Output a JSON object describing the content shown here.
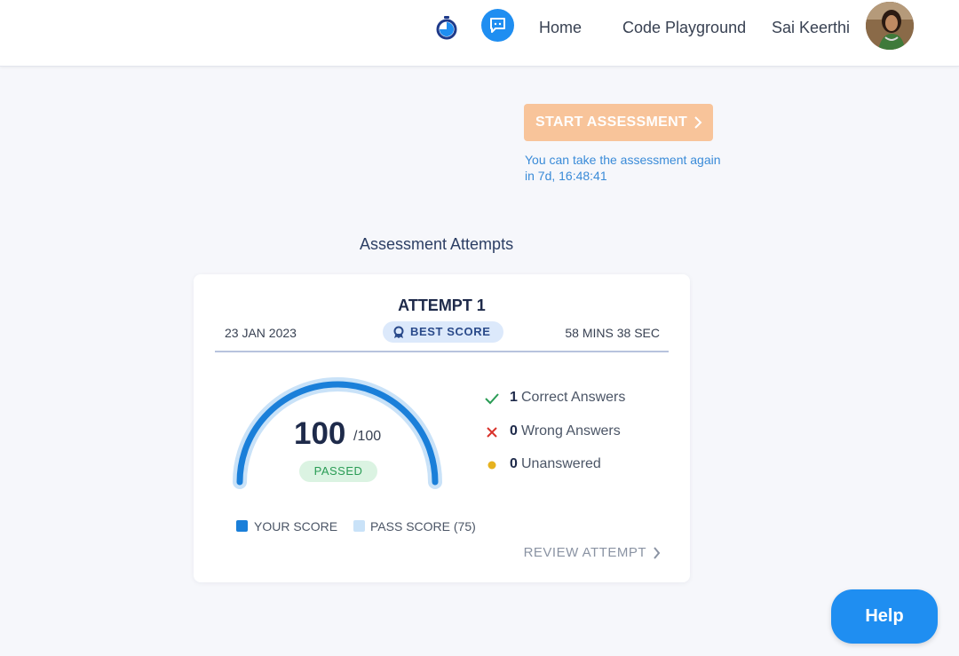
{
  "header": {
    "icons": {
      "timer": "stopwatch-icon",
      "chat": "chat-bubble-icon"
    },
    "nav": {
      "home": "Home",
      "code_playground": "Code Playground"
    },
    "user_name": "Sai Keerthi"
  },
  "assessment": {
    "start_label": "START ASSESSMENT",
    "retake_note": "You can take the assessment again in 7d, 16:48:41",
    "section_title": "Assessment Attempts"
  },
  "attempt": {
    "title": "ATTEMPT 1",
    "date": "23 JAN 2023",
    "badge": "BEST SCORE",
    "duration": "58 MINS 38 SEC",
    "score": "100",
    "score_total": "/100",
    "score_fraction": 1.0,
    "pass_fraction": 0.75,
    "status": "PASSED",
    "legend": {
      "your_score": "YOUR SCORE",
      "pass_score": "PASS SCORE (75)"
    },
    "stats": {
      "correct_count": "1",
      "correct_label": "Correct Answers",
      "wrong_count": "0",
      "wrong_label": "Wrong Answers",
      "unanswered_count": "0",
      "unanswered_label": "Unanswered"
    },
    "review_label": "REVIEW ATTEMPT"
  },
  "help_label": "Help",
  "colors": {
    "accent": "#1f8ef1",
    "score_arc": "#1a7fd9",
    "pass_arc": "#c9e2f8",
    "start_button": "#f8c49a",
    "passed_green": "#2a9c55",
    "wrong_red": "#d9322b",
    "unanswered_yellow": "#e6b21f"
  }
}
